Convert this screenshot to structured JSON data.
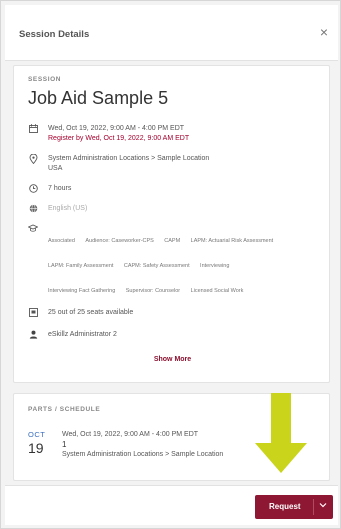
{
  "header": {
    "title": "Session Details",
    "close_label": "×"
  },
  "session": {
    "section_label": "SESSION",
    "title": "Job Aid Sample 5",
    "date_line": "Wed, Oct 19, 2022, 9:00 AM - 4:00 PM EDT",
    "register_by": "Register by Wed, Oct 19, 2022, 9:00 AM EDT",
    "location_line1": "System Administration Locations > Sample Location",
    "location_line2": "USA",
    "duration": "7 hours",
    "language": "English (US)",
    "tags": [
      "Associated",
      "Audience: Caseworker-CPS",
      "CAPM",
      "LAPM: Actuarial Risk Assessment",
      "LAPM: Family Assessment",
      "CAPM: Safety Assessment",
      "Interviewing",
      "Interviewing Fact Gathering",
      "Supervisor: Counselor",
      "Licensed Social Work"
    ],
    "seats": "25 out of 25 seats available",
    "instructor": "eSkillz Administrator 2",
    "show_more": "Show More"
  },
  "parts": {
    "section_label": "PARTS / SCHEDULE",
    "month": "OCT",
    "day": "19",
    "time_line": "Wed, Oct 19, 2022, 9:00 AM - 4:00 PM EDT",
    "number": "1",
    "location": "System Administration Locations > Sample Location"
  },
  "footer": {
    "request_label": "Request",
    "dropdown_icon": "chevron-down-icon"
  },
  "colors": {
    "accent": "#8e1733",
    "register_red": "#a4002d",
    "arrow": "#c9d41a",
    "month_blue": "#3b6fc2"
  }
}
